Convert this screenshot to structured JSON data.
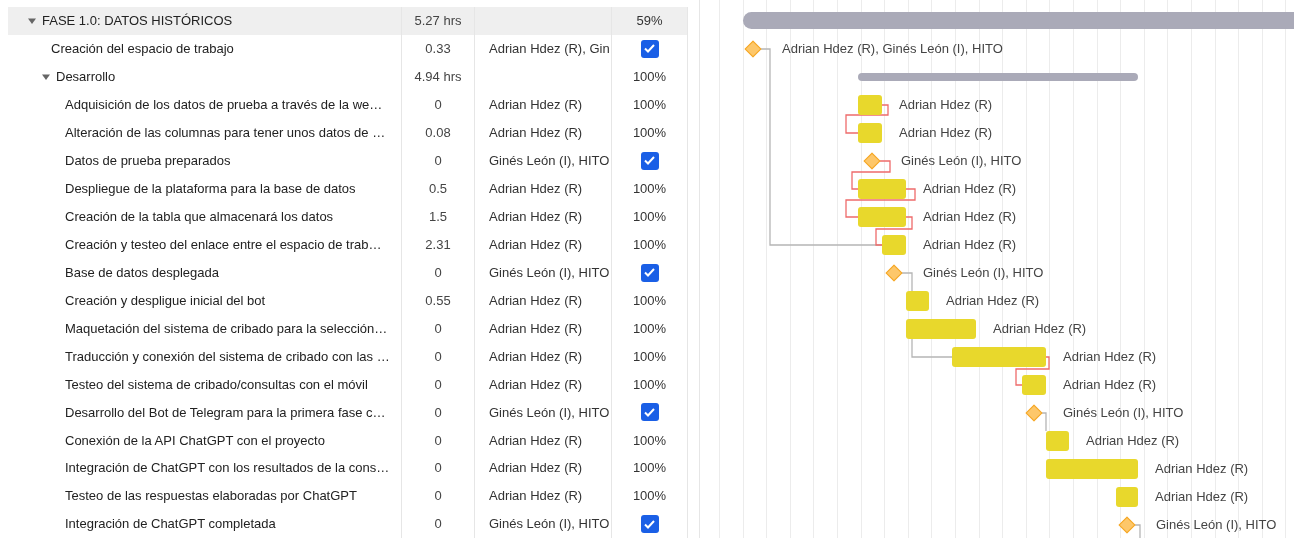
{
  "tasks": [
    {
      "name": "FASE 1.0: DATOS HISTÓRICOS",
      "hours": "5.27 hrs",
      "status": {
        "kind": "percent",
        "text": "59%"
      },
      "expanded": true,
      "children": [
        {
          "name": "Creación del espacio de trabajo",
          "hours": "0.33",
          "assignee": "Adrian Hdez (R), Gin",
          "status": {
            "kind": "check",
            "checked": true
          }
        },
        {
          "name": "Desarrollo",
          "hours": "4.94 hrs",
          "status": {
            "kind": "percent",
            "text": "100%"
          },
          "expanded": true,
          "children": [
            {
              "name": "Adquisición de los datos de prueba a través de la we…",
              "hours": "0",
              "assignee": "Adrian Hdez (R)",
              "status": {
                "kind": "percent",
                "text": "100%"
              }
            },
            {
              "name": "Alteración de las columnas para tener unos datos de …",
              "hours": "0.08",
              "assignee": "Adrian Hdez (R)",
              "status": {
                "kind": "percent",
                "text": "100%"
              }
            },
            {
              "name": "Datos de prueba preparados",
              "hours": "0",
              "assignee": "Ginés León (I), HITO",
              "status": {
                "kind": "check",
                "checked": true
              }
            },
            {
              "name": "Despliegue de la plataforma para la base de datos",
              "hours": "0.5",
              "assignee": "Adrian Hdez (R)",
              "status": {
                "kind": "percent",
                "text": "100%"
              }
            },
            {
              "name": "Creación de la tabla que almacenará los datos",
              "hours": "1.5",
              "assignee": "Adrian Hdez (R)",
              "status": {
                "kind": "percent",
                "text": "100%"
              }
            },
            {
              "name": "Creación y testeo del enlace entre el espacio de trab…",
              "hours": "2.31",
              "assignee": "Adrian Hdez (R)",
              "status": {
                "kind": "percent",
                "text": "100%"
              }
            },
            {
              "name": "Base de datos desplegada",
              "hours": "0",
              "assignee": "Ginés León (I), HITO",
              "status": {
                "kind": "check",
                "checked": true
              }
            },
            {
              "name": "Creación y despligue inicial del bot",
              "hours": "0.55",
              "assignee": "Adrian Hdez (R)",
              "status": {
                "kind": "percent",
                "text": "100%"
              }
            },
            {
              "name": "Maquetación del sistema de cribado para la selección…",
              "hours": "0",
              "assignee": "Adrian Hdez (R)",
              "status": {
                "kind": "percent",
                "text": "100%"
              }
            },
            {
              "name": "Traducción y conexión del sistema de cribado con las …",
              "hours": "0",
              "assignee": "Adrian Hdez (R)",
              "status": {
                "kind": "percent",
                "text": "100%"
              }
            },
            {
              "name": "Testeo del sistema de cribado/consultas con el móvil",
              "hours": "0",
              "assignee": "Adrian Hdez (R)",
              "status": {
                "kind": "percent",
                "text": "100%"
              }
            },
            {
              "name": "Desarrollo del Bot de Telegram para la primera fase c…",
              "hours": "0",
              "assignee": "Ginés León (I), HITO",
              "status": {
                "kind": "check",
                "checked": true
              }
            },
            {
              "name": "Conexión de la API ChatGPT con el proyecto",
              "hours": "0",
              "assignee": "Adrian Hdez (R)",
              "status": {
                "kind": "percent",
                "text": "100%"
              }
            },
            {
              "name": "Integración de ChatGPT con los resultados de la cons…",
              "hours": "0",
              "assignee": "Adrian Hdez (R)",
              "status": {
                "kind": "percent",
                "text": "100%"
              }
            },
            {
              "name": "Testeo de las respuestas elaboradas por ChatGPT",
              "hours": "0",
              "assignee": "Adrian Hdez (R)",
              "status": {
                "kind": "percent",
                "text": "100%"
              }
            },
            {
              "name": "Integración de ChatGPT completada",
              "hours": "0",
              "assignee": "Ginés León (I), HITO",
              "status": {
                "kind": "check",
                "checked": true
              }
            }
          ]
        }
      ]
    }
  ],
  "gantt": [
    {
      "kind": "summary"
    },
    {
      "kind": "milestone",
      "label": "Adrian Hdez (R), Ginés León (I), HITO"
    },
    {
      "kind": "subsummary"
    },
    {
      "kind": "bar",
      "label": "Adrian Hdez (R)"
    },
    {
      "kind": "bar",
      "label": "Adrian Hdez (R)"
    },
    {
      "kind": "milestone",
      "label": "Ginés León (I), HITO"
    },
    {
      "kind": "bar",
      "label": "Adrian Hdez (R)"
    },
    {
      "kind": "bar",
      "label": "Adrian Hdez (R)"
    },
    {
      "kind": "bar",
      "label": "Adrian Hdez (R)"
    },
    {
      "kind": "milestone",
      "label": "Ginés León (I), HITO"
    },
    {
      "kind": "bar",
      "label": "Adrian Hdez (R)"
    },
    {
      "kind": "bar",
      "label": "Adrian Hdez (R)"
    },
    {
      "kind": "bar",
      "label": "Adrian Hdez (R)"
    },
    {
      "kind": "bar",
      "label": "Adrian Hdez (R)"
    },
    {
      "kind": "milestone",
      "label": "Ginés León (I), HITO"
    },
    {
      "kind": "bar",
      "label": "Adrian Hdez (R)"
    },
    {
      "kind": "bar",
      "label": "Adrian Hdez (R)"
    },
    {
      "kind": "bar",
      "label": "Adrian Hdez (R)"
    },
    {
      "kind": "milestone",
      "label": "Ginés León (I), HITO"
    }
  ]
}
